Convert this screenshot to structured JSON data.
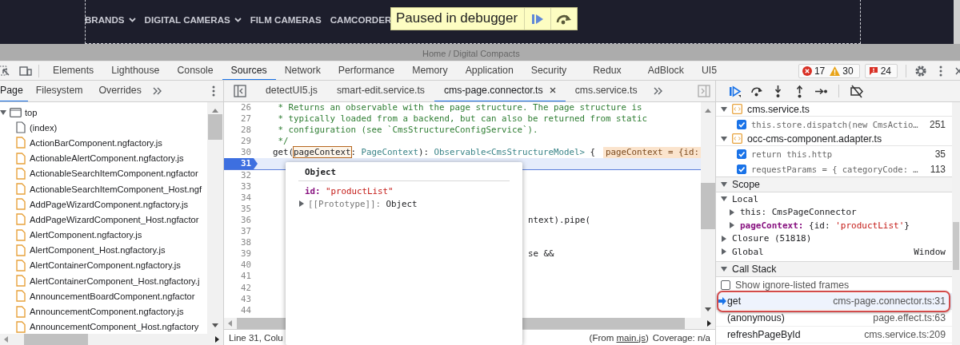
{
  "page": {
    "nav": [
      {
        "label": "BRANDS",
        "dropdown": true
      },
      {
        "label": "DIGITAL CAMERAS",
        "dropdown": true
      },
      {
        "label": "FILM CAMERAS",
        "dropdown": false
      },
      {
        "label": "CAMCORDER",
        "dropdown": false
      }
    ],
    "breadcrumb": "Home / Digital Compacts"
  },
  "paused_overlay": {
    "label": "Paused in debugger"
  },
  "devtools": {
    "tabs": [
      {
        "label": "Elements",
        "selected": false
      },
      {
        "label": "Lighthouse",
        "selected": false
      },
      {
        "label": "Console",
        "selected": false
      },
      {
        "label": "Sources",
        "selected": true
      },
      {
        "label": "Network",
        "selected": false
      },
      {
        "label": "Performance",
        "selected": false
      },
      {
        "label": "Memory",
        "selected": false
      },
      {
        "label": "Application",
        "selected": false
      },
      {
        "label": "Security",
        "selected": false
      },
      {
        "label": "Redux",
        "selected": false
      },
      {
        "label": "AdBlock",
        "selected": false
      },
      {
        "label": "UI5",
        "selected": false
      }
    ],
    "errors": "17",
    "warnings": "30",
    "issues": "24"
  },
  "navigator": {
    "tabs": [
      {
        "label": "Page",
        "selected": true
      },
      {
        "label": "Filesystem",
        "selected": false
      },
      {
        "label": "Overrides",
        "selected": false
      }
    ],
    "tree": {
      "label": "top",
      "expanded": true,
      "children": [
        {
          "label": "(index)",
          "kind": "document"
        },
        {
          "label": "ActionBarComponent.ngfactory.js",
          "kind": "script"
        },
        {
          "label": "ActionableAlertComponent.ngfactory.js",
          "kind": "script"
        },
        {
          "label": "ActionableSearchItemComponent.ngfactor",
          "kind": "script"
        },
        {
          "label": "ActionableSearchItemComponent_Host.ngf",
          "kind": "script"
        },
        {
          "label": "AddPageWizardComponent.ngfactory.js",
          "kind": "script"
        },
        {
          "label": "AddPageWizardComponent_Host.ngfactor",
          "kind": "script"
        },
        {
          "label": "AlertComponent.ngfactory.js",
          "kind": "script"
        },
        {
          "label": "AlertComponent_Host.ngfactory.js",
          "kind": "script"
        },
        {
          "label": "AlertContainerComponent.ngfactory.js",
          "kind": "script"
        },
        {
          "label": "AlertContainerComponent_Host.ngfactory.j",
          "kind": "script"
        },
        {
          "label": "AnnouncementBoardComponent.ngfactor",
          "kind": "script"
        },
        {
          "label": "AnnouncementComponent.ngfactory.js",
          "kind": "script"
        },
        {
          "label": "AnnouncementComponent_Host.ngfactory",
          "kind": "script"
        }
      ]
    }
  },
  "editor": {
    "tabs": [
      {
        "label": "detectUI5.js",
        "selected": false,
        "closable": false
      },
      {
        "label": "smart-edit.service.ts",
        "selected": false,
        "closable": false
      },
      {
        "label": "cms-page.connector.ts",
        "selected": true,
        "closable": true
      },
      {
        "label": "cms.service.ts",
        "selected": false,
        "closable": false
      }
    ],
    "lines": [
      {
        "number": "26",
        "current": false,
        "segments": [
          {
            "kind": "comment",
            "text": "   * Returns an observable with the page structure. The page structure is"
          }
        ]
      },
      {
        "number": "27",
        "current": false,
        "segments": [
          {
            "kind": "comment",
            "text": "   * typically loaded from a backend, but can also be returned from static"
          }
        ]
      },
      {
        "number": "28",
        "current": false,
        "segments": [
          {
            "kind": "comment",
            "text": "   * configuration (see `CmsStructureConfigService`)."
          }
        ]
      },
      {
        "number": "29",
        "current": false,
        "segments": [
          {
            "kind": "comment",
            "text": "   */"
          }
        ]
      },
      {
        "number": "30",
        "current": false,
        "segments": [
          {
            "kind": "plain",
            "text": "  get("
          },
          {
            "kind": "hovered",
            "text": "pageContext"
          },
          {
            "kind": "plain",
            "text": ": "
          },
          {
            "kind": "type",
            "text": "PageContext"
          },
          {
            "kind": "plain",
            "text": "): "
          },
          {
            "kind": "type",
            "text": "Observable<CmsStructureModel>"
          },
          {
            "kind": "plain",
            "text": " {"
          }
        ],
        "inline_value": "pageContext = {id:"
      },
      {
        "number": "31",
        "current": true
      },
      {
        "number": "32",
        "current": false
      },
      {
        "number": "33",
        "current": false
      },
      {
        "number": "34",
        "current": false
      },
      {
        "number": "35",
        "current": false
      },
      {
        "number": "36",
        "current": false,
        "segments": [
          {
            "kind": "behind_popup",
            "text": "ntext).pipe("
          }
        ]
      },
      {
        "number": "37",
        "current": false
      },
      {
        "number": "38",
        "current": false
      },
      {
        "number": "39",
        "current": false,
        "segments": [
          {
            "kind": "behind_popup",
            "text": "se &&"
          }
        ]
      },
      {
        "number": "40",
        "current": false
      },
      {
        "number": "41",
        "current": false
      },
      {
        "number": "42",
        "current": false
      },
      {
        "number": "43",
        "current": false
      },
      {
        "number": "44",
        "current": false
      }
    ],
    "popup": {
      "title": "Object",
      "properties": [
        {
          "kind": "value",
          "key": "id:",
          "value": "\"productList\""
        },
        {
          "kind": "prototype",
          "key": "[[Prototype]]:",
          "value": "Object"
        }
      ]
    },
    "status": {
      "position": "Line 31, Colu",
      "source_prefix": "(From ",
      "source_link": "main.js",
      "source_suffix": ")",
      "coverage": "Coverage: n/a"
    }
  },
  "debugger": {
    "breakpoints": [
      {
        "file": "cms.service.ts",
        "expanded": true,
        "items": [
          {
            "code": "this.store.dispatch(new CmsActio…",
            "line": "251",
            "checked": true
          }
        ]
      },
      {
        "file": "occ-cms-component.adapter.ts",
        "expanded": true,
        "items": [
          {
            "code": "return this.http",
            "line": "35",
            "checked": true
          },
          {
            "code": "requestParams = { categoryCode: …",
            "line": "113",
            "checked": true
          }
        ]
      }
    ],
    "scope": {
      "title": "Scope",
      "expanded": true,
      "groups": [
        {
          "label": "Local",
          "expanded": true,
          "children": [
            {
              "key": "this:",
              "value": [
                {
                  "kind": "plain",
                  "text": "CmsPageConnector"
                }
              ],
              "kind": "object"
            },
            {
              "key": "pageContext:",
              "value": [
                {
                  "kind": "plain",
                  "text": "{id: "
                },
                {
                  "kind": "string",
                  "text": "'productList'"
                },
                {
                  "kind": "plain",
                  "text": "}"
                }
              ],
              "kind": "argument"
            }
          ]
        },
        {
          "label": "Closure (51818)",
          "expanded": false
        },
        {
          "label": "Global",
          "expanded": false,
          "value": "Window"
        }
      ]
    },
    "call_stack": {
      "title": "Call Stack",
      "expanded": true,
      "show_ignore_listed": {
        "label": "Show ignore-listed frames",
        "checked": false
      },
      "frames": [
        {
          "name": "get",
          "location": "cms-page.connector.ts:31",
          "selected": true,
          "highlighted": true
        },
        {
          "name": "(anonymous)",
          "location": "page.effect.ts:63",
          "selected": false,
          "highlighted": false
        },
        {
          "name": "refreshPageById",
          "location": "cms.service.ts:209",
          "selected": false,
          "highlighted": false
        }
      ]
    }
  }
}
